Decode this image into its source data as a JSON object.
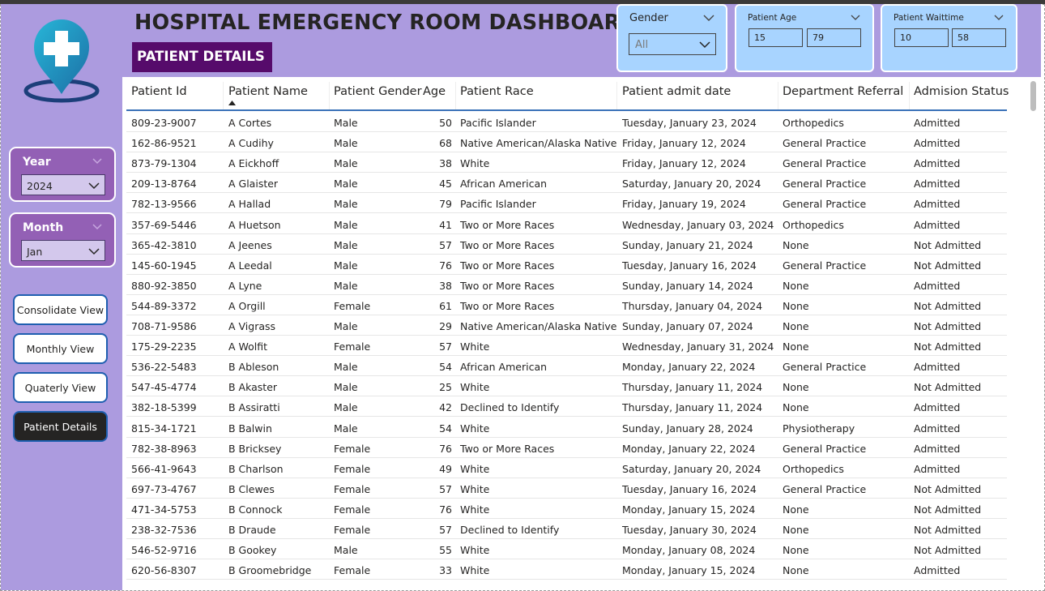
{
  "header": {
    "title": "HOSPITAL EMERGENCY ROOM DASHBOARD",
    "subtitle": "PATIENT DETAILS"
  },
  "filters": {
    "year": {
      "label": "Year",
      "value": "2024"
    },
    "month": {
      "label": "Month",
      "value": "Jan"
    },
    "gender": {
      "label": "Gender",
      "value": "All"
    },
    "age": {
      "label": "Patient Age",
      "min": "15",
      "max": "79"
    },
    "waittime": {
      "label": "Patient Waittime",
      "min": "10",
      "max": "58"
    }
  },
  "nav": {
    "consolidate": "Consolidate View",
    "monthly": "Monthly View",
    "quarterly": "Quaterly View",
    "details": "Patient Details"
  },
  "colors": {
    "sidebar": "#ac9bdf",
    "slicer_purple": "#9360b5",
    "subtitle_bg": "#560b6b",
    "slicer_blue": "#a8d4ff",
    "header_line": "#3a72b8",
    "logo": "#1fa0c8"
  },
  "icons": {
    "logo": "medical-location-pin-icon",
    "dropdown": "chevron-down-icon",
    "sort": "sort-ascending-icon"
  },
  "table": {
    "columns": [
      "Patient Id",
      "Patient Name",
      "Patient Gender",
      "Age",
      "Patient Race",
      "Patient admit date",
      "Department Referral",
      "Admision Status"
    ],
    "rows": [
      [
        "809-23-9007",
        "A Cortes",
        "Male",
        "50",
        "Pacific Islander",
        "Tuesday, January 23, 2024",
        "Orthopedics",
        "Admitted"
      ],
      [
        "162-86-9521",
        "A Cudihy",
        "Male",
        "68",
        "Native American/Alaska Native",
        "Friday, January 12, 2024",
        "General Practice",
        "Admitted"
      ],
      [
        "873-79-1304",
        "A Eickhoff",
        "Male",
        "38",
        "White",
        "Friday, January 12, 2024",
        "General Practice",
        "Admitted"
      ],
      [
        "209-13-8764",
        "A Glaister",
        "Male",
        "45",
        "African American",
        "Saturday, January 20, 2024",
        "General Practice",
        "Admitted"
      ],
      [
        "782-13-9566",
        "A Hallad",
        "Male",
        "79",
        "Pacific Islander",
        "Friday, January 19, 2024",
        "General Practice",
        "Admitted"
      ],
      [
        "357-69-5446",
        "A Huetson",
        "Male",
        "41",
        "Two or More Races",
        "Wednesday, January 03, 2024",
        "Orthopedics",
        "Admitted"
      ],
      [
        "365-42-3810",
        "A Jeenes",
        "Male",
        "57",
        "Two or More Races",
        "Sunday, January 21, 2024",
        "None",
        "Not Admitted"
      ],
      [
        "145-60-1945",
        "A Leedal",
        "Male",
        "76",
        "Two or More Races",
        "Tuesday, January 16, 2024",
        "General Practice",
        "Not Admitted"
      ],
      [
        "880-92-3850",
        "A Lyne",
        "Male",
        "38",
        "Two or More Races",
        "Sunday, January 14, 2024",
        "None",
        "Admitted"
      ],
      [
        "544-89-3372",
        "A Orgill",
        "Female",
        "61",
        "Two or More Races",
        "Thursday, January 04, 2024",
        "None",
        "Not Admitted"
      ],
      [
        "708-71-9586",
        "A Vigrass",
        "Male",
        "29",
        "Native American/Alaska Native",
        "Sunday, January 07, 2024",
        "None",
        "Not Admitted"
      ],
      [
        "175-29-2235",
        "A Wolfit",
        "Female",
        "57",
        "White",
        "Wednesday, January 31, 2024",
        "None",
        "Not Admitted"
      ],
      [
        "536-22-5483",
        "B Ableson",
        "Male",
        "54",
        "African American",
        "Monday, January 22, 2024",
        "General Practice",
        "Admitted"
      ],
      [
        "547-45-4774",
        "B Akaster",
        "Male",
        "25",
        "White",
        "Thursday, January 11, 2024",
        "None",
        "Not Admitted"
      ],
      [
        "382-18-5399",
        "B Assiratti",
        "Male",
        "42",
        "Declined to Identify",
        "Thursday, January 11, 2024",
        "None",
        "Admitted"
      ],
      [
        "815-34-1721",
        "B Balwin",
        "Male",
        "54",
        "White",
        "Sunday, January 28, 2024",
        "Physiotherapy",
        "Admitted"
      ],
      [
        "782-38-8963",
        "B Bricksey",
        "Female",
        "76",
        "Two or More Races",
        "Monday, January 22, 2024",
        "General Practice",
        "Admitted"
      ],
      [
        "566-41-9643",
        "B Charlson",
        "Female",
        "49",
        "White",
        "Saturday, January 20, 2024",
        "Orthopedics",
        "Admitted"
      ],
      [
        "697-73-4767",
        "B Clewes",
        "Female",
        "57",
        "White",
        "Tuesday, January 16, 2024",
        "General Practice",
        "Not Admitted"
      ],
      [
        "471-34-5753",
        "B Connock",
        "Female",
        "76",
        "White",
        "Monday, January 15, 2024",
        "None",
        "Not Admitted"
      ],
      [
        "238-32-7536",
        "B Draude",
        "Female",
        "57",
        "Declined to Identify",
        "Tuesday, January 30, 2024",
        "None",
        "Not Admitted"
      ],
      [
        "546-52-9716",
        "B Gookey",
        "Male",
        "55",
        "White",
        "Monday, January 08, 2024",
        "None",
        "Not Admitted"
      ],
      [
        "620-56-8307",
        "B Groomebridge",
        "Female",
        "33",
        "White",
        "Monday, January 15, 2024",
        "None",
        "Admitted"
      ]
    ]
  }
}
